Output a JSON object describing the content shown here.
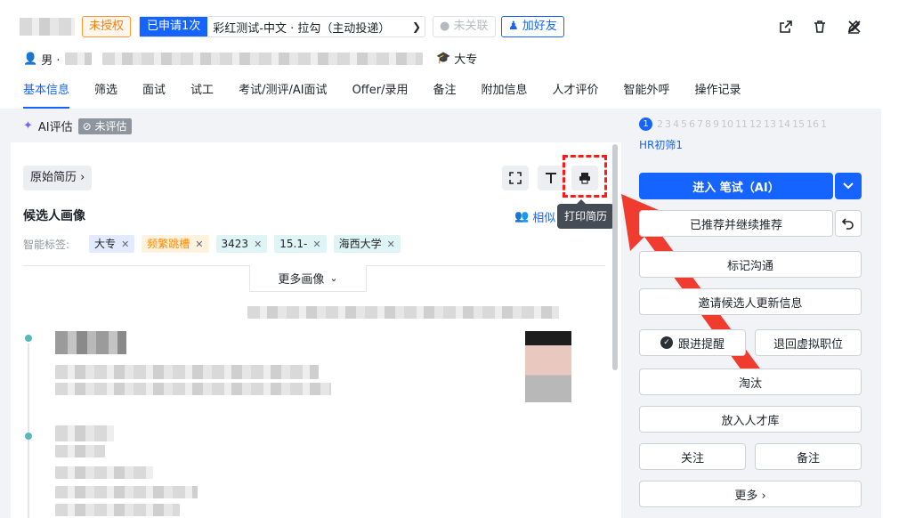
{
  "header": {
    "badge_unauthorized": "未授权",
    "applied_tag": "已申请1次",
    "applied_text": "彩红测试-中文 · 拉勾（主动投递）",
    "badge_unlinked": "未关联",
    "badge_friend": "加好友",
    "gender": "男 ·",
    "degree": "大专"
  },
  "tabs": [
    "基本信息",
    "筛选",
    "面试",
    "试工",
    "考试/测评/AI面试",
    "Offer/录用",
    "备注",
    "附加信息",
    "人才评价",
    "智能外呼",
    "操作记录"
  ],
  "ai": {
    "label": "AI评估",
    "status": "未评估"
  },
  "resume": {
    "original_btn": "原始简历 ›",
    "tooltip": "打印简历",
    "section_title": "候选人画像",
    "similar_label": "相似",
    "tags_label": "智能标签:",
    "tags": [
      {
        "text": "大专",
        "style": "blue"
      },
      {
        "text": "频繁跳槽",
        "style": "orange"
      },
      {
        "text": "3423",
        "style": "cyan"
      },
      {
        "text": "15.1-",
        "style": "cyan"
      },
      {
        "text": "海西大学",
        "style": "cyan"
      }
    ],
    "more_portrait": "更多画像"
  },
  "right": {
    "steps": [
      "1",
      "2",
      "3",
      "4",
      "5",
      "6",
      "7",
      "8",
      "9",
      "10",
      "11",
      "12",
      "13",
      "14",
      "15",
      "16",
      "1"
    ],
    "hr_label": "HR初筛1",
    "enter_exam": "进入 笔试（AI）",
    "recommended": "已推荐并继续推荐",
    "mark_comm": "标记沟通",
    "invite_update": "邀请候选人更新信息",
    "follow_remind": "跟进提醒",
    "return_virtual": "退回虚拟职位",
    "eliminate": "淘汰",
    "talent_pool": "放入人才库",
    "follow": "关注",
    "note": "备注",
    "more": "更多 ›"
  },
  "colors": {
    "primary": "#1664ff",
    "highlight": "#ff1a1a",
    "arrow": "#f03c2e"
  }
}
